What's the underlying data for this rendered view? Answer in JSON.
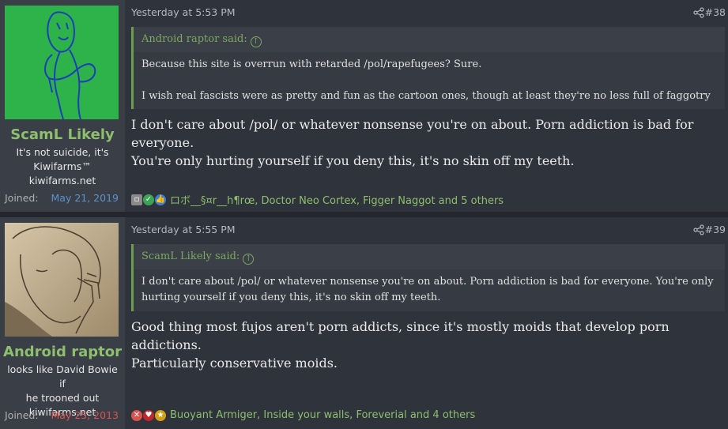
{
  "posts": [
    {
      "user": {
        "name": "ScamL Likely",
        "title_lines": [
          "It's not suicide, it's",
          "Kiwifarms™",
          "kiwifarms.net"
        ],
        "joined_label": "Joined:",
        "joined_date": "May 21, 2019"
      },
      "timestamp": "Yesterday at 5:53 PM",
      "number": "#38",
      "quote": {
        "author": "Android raptor said:",
        "paragraphs": [
          "Because this site is overrun with retarded /pol/rapefugees? Sure.",
          "I wish real fascists were as pretty and fun as the cartoon ones, though at least they're no less full of faggotry"
        ]
      },
      "content_lines": [
        "I don't care about /pol/ or whatever nonsense you're on about. Porn addiction is bad for everyone.",
        "You're only hurting yourself if you deny this, it's no skin off my teeth."
      ],
      "reactions": {
        "icons": [
          "dumb-icon",
          "agree-icon",
          "like-icon"
        ],
        "text": "ロボ__§¤r__h¶rœ, Doctor Neo Cortex, Figger Naggot and 5 others"
      }
    },
    {
      "user": {
        "name": "Android raptor",
        "title_lines": [
          "looks like David Bowie if",
          "he trooned out",
          "kiwifarms.net"
        ],
        "joined_label": "Joined:",
        "joined_date": "May 25, 2013"
      },
      "timestamp": "Yesterday at 5:55 PM",
      "number": "#39",
      "quote": {
        "author": "ScamL Likely said:",
        "paragraphs": [
          "I don't care about /pol/ or whatever nonsense you're on about. Porn addiction is bad for everyone. You're only hurting yourself if you deny this, it's no skin off my teeth."
        ]
      },
      "content_lines": [
        "Good thing most fujos aren't porn addicts, since it's mostly moids that develop porn addictions.",
        "Particularly conservative moids."
      ],
      "reactions": {
        "icons": [
          "disagree-icon",
          "heart-icon",
          "winner-icon"
        ],
        "text": "Buoyant Armiger, Inside your walls, Foreverial and 4 others"
      }
    }
  ],
  "colors": {
    "accent_green": "#8dbf6e",
    "quote_bar": "#6c9c4d",
    "joined_blue": "#5b93c9",
    "joined_red": "#d9534f"
  }
}
